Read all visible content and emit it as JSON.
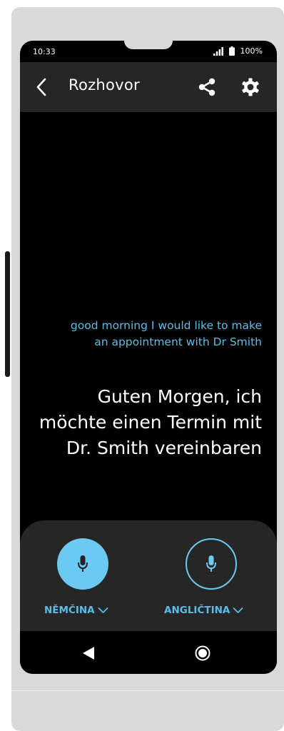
{
  "status_bar": {
    "time": "10:33",
    "battery": "100%",
    "signal_icon": "signal-icon",
    "battery_icon": "battery-icon"
  },
  "app_bar": {
    "title": "Rozhovor",
    "back_icon": "chevron-left-icon",
    "share_icon": "share-icon",
    "settings_icon": "settings-gear-icon"
  },
  "conversation": {
    "source_text": "good morning I would like to make an appointment with Dr Smith",
    "translated_text": "Guten Morgen, ich möchte einen Termin mit Dr. Smith vereinbaren"
  },
  "controls": {
    "left_language": "NĚMČINA",
    "right_language": "ANGLIČTINA",
    "left_mic_active": true,
    "right_mic_active": false,
    "mic_icon": "microphone-icon",
    "dropdown_icon": "chevron-down-icon"
  },
  "colors": {
    "accent": "#6cc9f2",
    "source_text": "#5bbde8",
    "panel": "#262626",
    "background": "#000000",
    "frame": "#d9d9d9"
  },
  "nav_bar": {
    "back_icon": "triangle-back-icon",
    "home_icon": "home-circle-icon"
  }
}
